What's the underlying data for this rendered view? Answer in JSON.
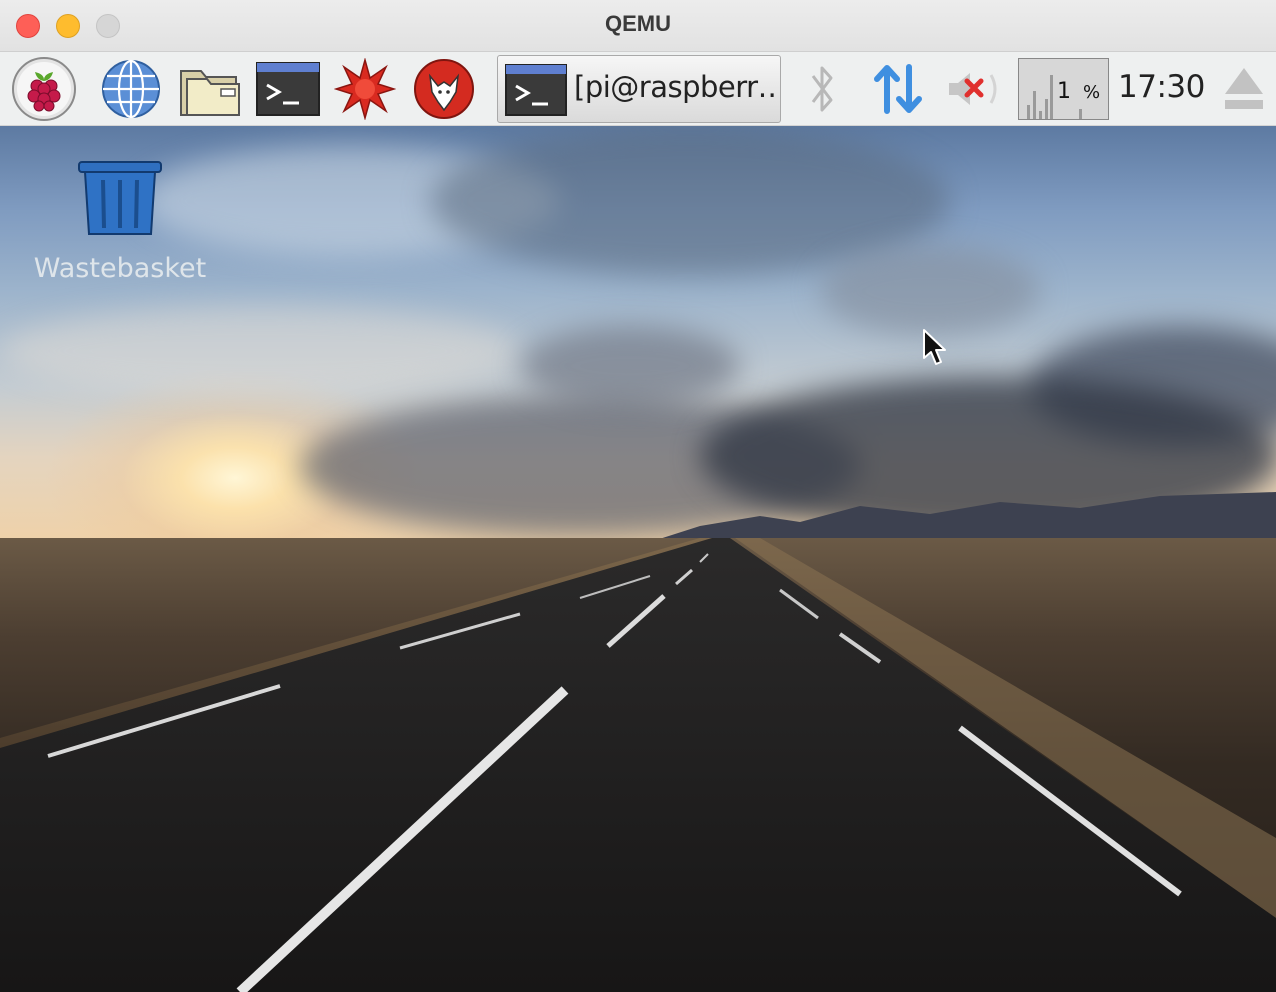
{
  "window": {
    "title": "QEMU"
  },
  "panel": {
    "launchers": [
      {
        "name": "raspberry-menu",
        "icon": "raspberry-icon"
      },
      {
        "name": "web-browser",
        "icon": "globe-icon"
      },
      {
        "name": "file-manager",
        "icon": "folder-icon"
      },
      {
        "name": "terminal",
        "icon": "terminal-icon"
      },
      {
        "name": "mathematica",
        "icon": "mathematica-icon"
      },
      {
        "name": "wolfram",
        "icon": "wolfram-icon"
      }
    ],
    "task": {
      "label": "[pi@raspberr…",
      "icon": "terminal-icon"
    },
    "tray": {
      "bluetooth": "bluetooth-icon",
      "network": "network-updown-icon",
      "volume": "volume-muted-icon",
      "cpu_value": "1",
      "cpu_unit": "%",
      "clock": "17:30",
      "eject": "eject-icon"
    }
  },
  "desktop": {
    "icons": [
      {
        "label": "Wastebasket",
        "icon": "trash-icon"
      }
    ]
  },
  "colors": {
    "accent_blue": "#3f8fe0",
    "mute_red": "#e0302e",
    "panel_bg": "#eef0f0"
  }
}
